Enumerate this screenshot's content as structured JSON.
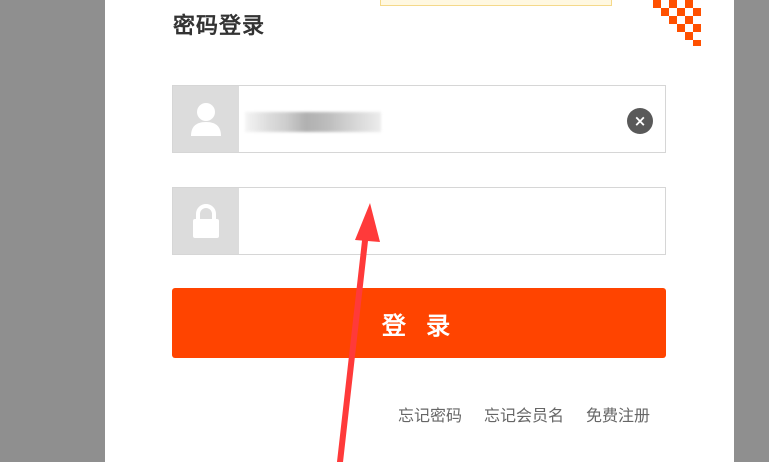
{
  "login": {
    "title": "密码登录",
    "username": {
      "value": "",
      "clear_icon": "close-icon"
    },
    "password": {
      "value": ""
    },
    "submit_label": "登 录"
  },
  "links": {
    "forgot_password": "忘记密码",
    "forgot_username": "忘记会员名",
    "register": "免费注册"
  },
  "colors": {
    "primary": "#ff4400",
    "annotation_arrow": "#ff3a3a",
    "icon_box": "#dcdcdc",
    "backdrop": "#8f8f8f"
  }
}
